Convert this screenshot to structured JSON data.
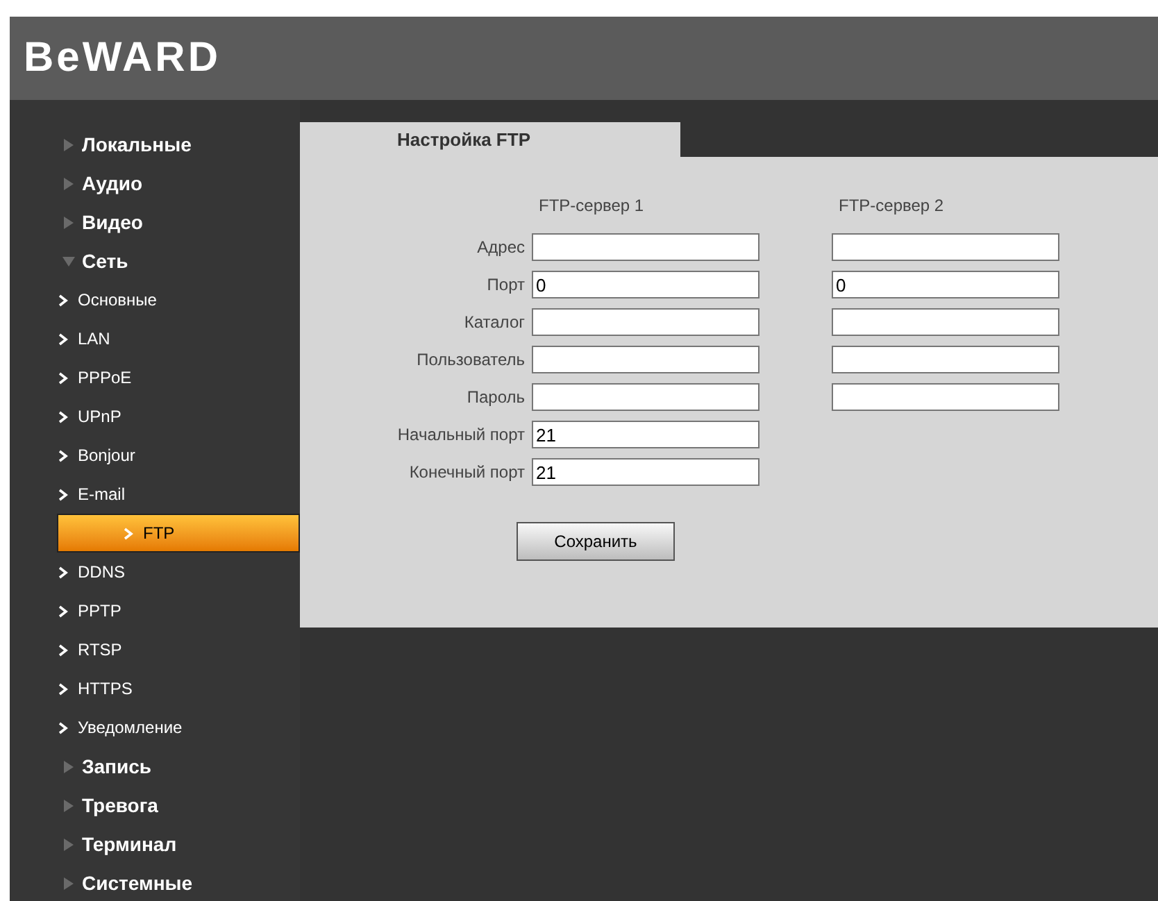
{
  "logo": "BeWARD",
  "sidebar": {
    "items": [
      {
        "label": "Локальные",
        "expanded": false
      },
      {
        "label": "Аудио",
        "expanded": false
      },
      {
        "label": "Видео",
        "expanded": false
      },
      {
        "label": "Сеть",
        "expanded": true,
        "children": [
          {
            "label": "Основные",
            "selected": false
          },
          {
            "label": "LAN",
            "selected": false
          },
          {
            "label": "PPPoE",
            "selected": false
          },
          {
            "label": "UPnP",
            "selected": false
          },
          {
            "label": "Bonjour",
            "selected": false
          },
          {
            "label": "E-mail",
            "selected": false
          },
          {
            "label": "FTP",
            "selected": true
          },
          {
            "label": "DDNS",
            "selected": false
          },
          {
            "label": "PPTP",
            "selected": false
          },
          {
            "label": "RTSP",
            "selected": false
          },
          {
            "label": "HTTPS",
            "selected": false
          },
          {
            "label": "Уведомление",
            "selected": false
          }
        ]
      },
      {
        "label": "Запись",
        "expanded": false
      },
      {
        "label": "Тревога",
        "expanded": false
      },
      {
        "label": "Терминал",
        "expanded": false
      },
      {
        "label": "Системные",
        "expanded": false
      }
    ]
  },
  "panel": {
    "tab": "Настройка FTP",
    "columns": [
      "FTP-сервер 1",
      "FTP-сервер 2"
    ],
    "rows": [
      {
        "label": "Адрес",
        "kind": "both"
      },
      {
        "label": "Порт",
        "kind": "both",
        "value_1": "0",
        "value_2": "0"
      },
      {
        "label": "Каталог",
        "kind": "both"
      },
      {
        "label": "Пользователь",
        "kind": "both"
      },
      {
        "label": "Пароль",
        "kind": "both"
      },
      {
        "label": "Начальный порт",
        "kind": "first",
        "value_1": "21"
      },
      {
        "label": "Конечный порт",
        "kind": "first",
        "value_1": "21"
      }
    ],
    "button": "Сохранить"
  }
}
